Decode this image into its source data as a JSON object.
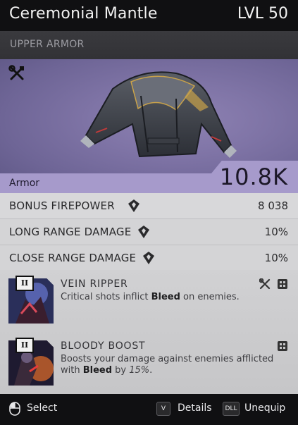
{
  "header": {
    "title": "Ceremonial Mantle",
    "level": "LVL 50"
  },
  "item": {
    "category": "UPPER ARMOR",
    "armor_label": "Armor",
    "armor_value": "10.8K"
  },
  "stats": [
    {
      "label": "BONUS FIREPOWER",
      "value": "8 038",
      "icon": "diamond-emblem-icon"
    },
    {
      "label": "LONG RANGE DAMAGE",
      "value": "10%",
      "icon": "diamond-emblem-icon"
    },
    {
      "label": "CLOSE RANGE DAMAGE",
      "value": "10%",
      "icon": "diamond-emblem-icon"
    }
  ],
  "perks": [
    {
      "rank": "II",
      "name": "VEIN RIPPER",
      "desc_pre": "Critical shots inflict ",
      "desc_bold": "Bleed",
      "desc_post": " on enemies.",
      "icons": [
        "tools-icon",
        "grid-slot-icon"
      ]
    },
    {
      "rank": "II",
      "name": "BLOODY BOOST",
      "desc_pre": "Boosts your damage against enemies afflicted with ",
      "desc_bold": "Bleed",
      "desc_mid": " by ",
      "desc_italic": "15%",
      "desc_post": ".",
      "icons": [
        "grid-slot-icon"
      ]
    }
  ],
  "footer": {
    "select_label": "Select",
    "details_key": "V",
    "details_label": "Details",
    "unequip_key": "DLL",
    "unequip_label": "Unequip"
  },
  "colors": {
    "accent": "#a69acb",
    "header_bg": "#101012",
    "stat_bg": "#d8d8da"
  }
}
